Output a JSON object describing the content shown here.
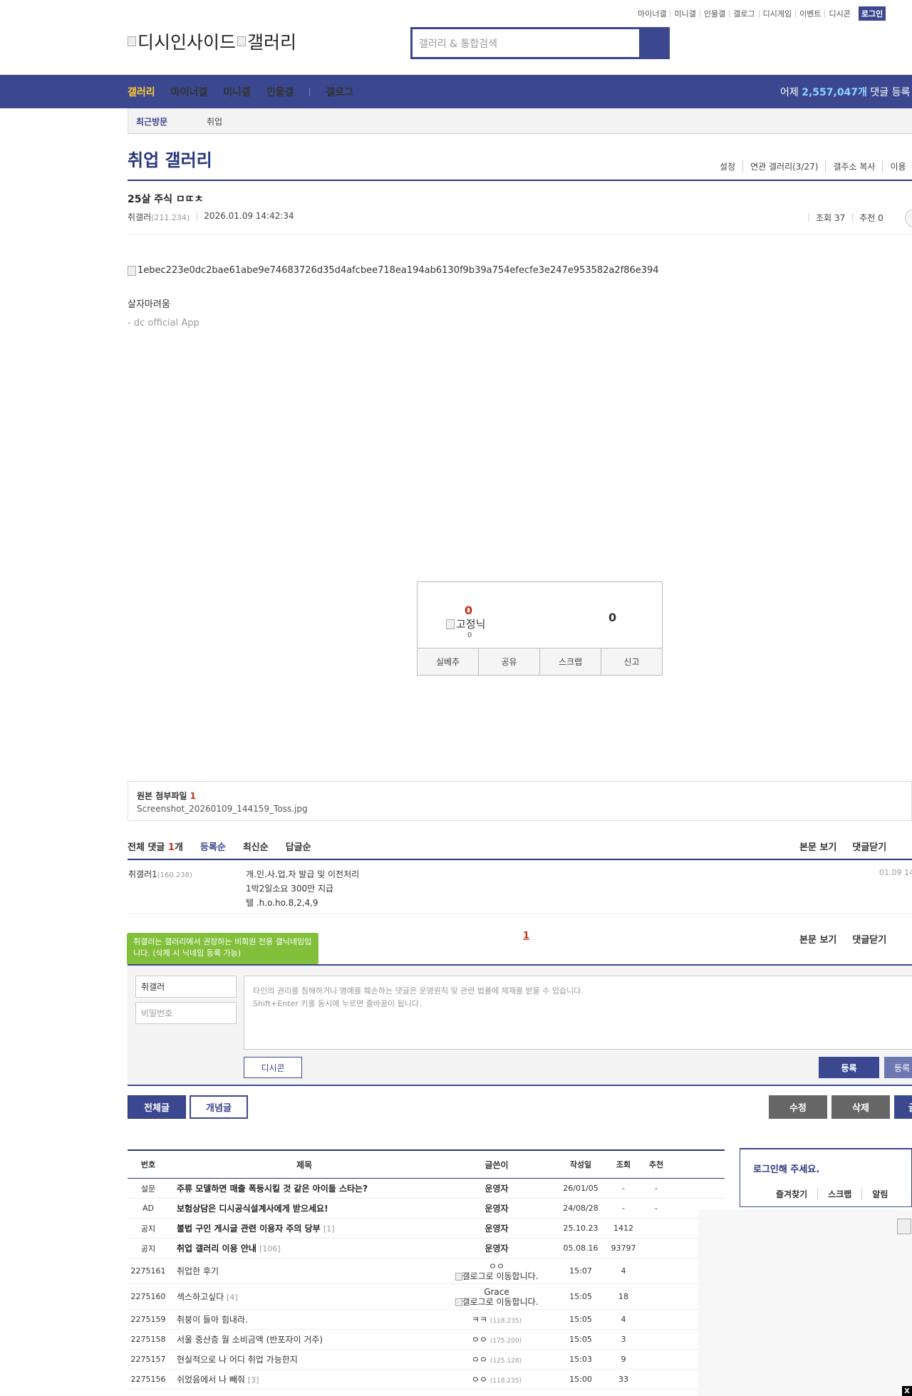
{
  "top_links": [
    "마이너갤",
    "미니갤",
    "인물갤",
    "갤로그",
    "디시게임",
    "이벤트",
    "디시콘"
  ],
  "login": "로그인",
  "logo": {
    "left": "디시인사이드",
    "right": "갤러리"
  },
  "search": {
    "placeholder": "갤러리 & 통합검색"
  },
  "nav": {
    "items": [
      "갤러리",
      "마이너갤",
      "미니갤",
      "인물갤",
      "갤로그"
    ]
  },
  "stats": {
    "prefix": "어제",
    "value": "2,557,047개",
    "suffix": "댓글 등록"
  },
  "subnav": {
    "recent": "최근방문",
    "item": "취업"
  },
  "gallery": {
    "title": "취업 갤러리",
    "menu": [
      "설정",
      "연관 갤러리(3/27)",
      "갤주소 복사",
      "이용"
    ]
  },
  "post": {
    "title": "25살 주식 ㅁㄸㅊ",
    "author": "취갤러",
    "author_ip": "(211.234)",
    "date": "2026.01.09 14:42:34",
    "views": "조회 37",
    "recommends": "추천 0",
    "image_alt": "1ebec223e0dc2bae61abe9e74683726d35d4afcbee718ea194ab6130f9b39a754efecfe3e247e953582a2f86e394",
    "body": "살자마려움",
    "signature": "- dc official App"
  },
  "recommend": {
    "up": "0",
    "fixed_alt": "고정닉",
    "fixed_count": "0",
    "down": "0",
    "buttons": [
      "실베추",
      "공유",
      "스크랩",
      "신고"
    ]
  },
  "attachment": {
    "label": "원본 첨부파일",
    "count": "1",
    "filename": "Screenshot_20260109_144159_Toss.jpg"
  },
  "comments": {
    "total_label": "전체 댓글",
    "total_count": "1",
    "total_suffix": "개",
    "sort": [
      "등록순",
      "최신순",
      "답글순"
    ],
    "right": [
      "본문 보기",
      "댓글닫기"
    ],
    "items": [
      {
        "nick": "취갤러1",
        "ip": "(160.238)",
        "lines": [
          "개.인.사.업.자 발급 및 이전처리",
          "1박2일소요 300만 지급",
          "텔 .h.o.ho.8,2,4,9"
        ],
        "date": "01.09 14"
      }
    ],
    "page": "1"
  },
  "write": {
    "tip": "취갤러는 갤러리에서 권장하는 비회원 전용 갤닉네임입니다. (삭제 시 닉네임 등록 가능)",
    "nick": "취갤러",
    "password_placeholder": "비밀번호",
    "textarea_line1": "타인의 권리를 침해하거나 명예를 훼손하는 댓글은 운영원칙 및 관련 법률에 제재를 받을 수 있습니다.",
    "textarea_line2": "Shift+Enter 키를 동시에 누르면 줄바꿈이 됩니다.",
    "dccon": "디시콘",
    "submit": "등록",
    "submit2": "등록"
  },
  "buttons": {
    "all": "전체글",
    "concept": "개념글",
    "edit": "수정",
    "delete": "삭제",
    "write": "글"
  },
  "list": {
    "headers": [
      "번호",
      "제목",
      "글쓴이",
      "작성일",
      "조회",
      "추천"
    ],
    "rows": [
      {
        "no": "설문",
        "title": "주류 모델하면 매출 폭등시킬 것 같은 아이돌 스타는?",
        "count": "",
        "writer": "운영자",
        "writer2": "",
        "ip": "",
        "date": "26/01/05",
        "views": "-",
        "rec": "-",
        "bold": true
      },
      {
        "no": "AD",
        "title": "보험상담은 디시공식설계사에게 받으세요!",
        "count": "",
        "writer": "운영자",
        "writer2": "",
        "ip": "",
        "date": "24/08/28",
        "views": "-",
        "rec": "-",
        "bold": true
      },
      {
        "no": "공지",
        "title": "불법 구인 게시글 관련 이용자 주의 당부",
        "count": "[1]",
        "writer": "운영자",
        "writer2": "",
        "ip": "",
        "date": "25.10.23",
        "views": "1412",
        "rec": "",
        "bold": true
      },
      {
        "no": "공지",
        "title": "취업 갤러리 이용 안내",
        "count": "[106]",
        "writer": "운영자",
        "writer2": "",
        "ip": "",
        "date": "05.08.16",
        "views": "93797",
        "rec": "",
        "bold": true
      },
      {
        "no": "2275161",
        "title": "취업한 후기",
        "count": "",
        "writer": "ㅇㅇ",
        "writer2": "갤로그로 이동합니다.",
        "ip": "",
        "date": "15:07",
        "views": "4",
        "rec": "",
        "bold": false
      },
      {
        "no": "2275160",
        "title": "섹스하고싶다",
        "count": "[4]",
        "writer": "Grace",
        "writer2": "갤로그로 이동합니다.",
        "ip": "",
        "date": "15:05",
        "views": "18",
        "rec": "",
        "bold": false
      },
      {
        "no": "2275159",
        "title": "취붕이 들아 힘내라.",
        "count": "",
        "writer": "ㅋㅋ",
        "writer2": "",
        "ip": "(118.235)",
        "date": "15:05",
        "views": "4",
        "rec": "",
        "bold": false
      },
      {
        "no": "2275158",
        "title": "서울 중산층 월 소비금액 (반포자이 거주)",
        "count": "",
        "writer": "ㅇㅇ",
        "writer2": "",
        "ip": "(175.200)",
        "date": "15:05",
        "views": "3",
        "rec": "",
        "bold": false
      },
      {
        "no": "2275157",
        "title": "현실적으로 나 어디 취업 가능한지",
        "count": "",
        "writer": "ㅇㅇ",
        "writer2": "",
        "ip": "(125.128)",
        "date": "15:03",
        "views": "9",
        "rec": "",
        "bold": false
      },
      {
        "no": "2275156",
        "title": "쉬었음에서 나 빼줘",
        "count": "[3]",
        "writer": "ㅇㅇ",
        "writer2": "",
        "ip": "(118.235)",
        "date": "15:00",
        "views": "33",
        "rec": "",
        "bold": false
      }
    ]
  },
  "sidebox": {
    "title": "로그인해 주세요.",
    "menu": [
      "즐겨찾기",
      "스크랩",
      "알림"
    ]
  }
}
